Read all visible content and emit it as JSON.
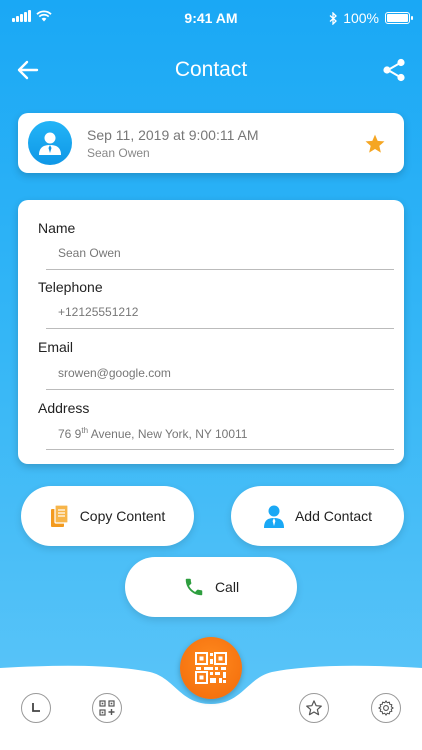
{
  "status_bar": {
    "time": "9:41 AM",
    "battery_text": "100%",
    "battery_level": 1.0
  },
  "header": {
    "title": "Contact"
  },
  "history_item": {
    "timestamp": "Sep 11, 2019 at 9:00:11 AM",
    "name": "Sean Owen",
    "favorited": true
  },
  "contact": {
    "fields": [
      {
        "label": "Name",
        "value": "Sean Owen"
      },
      {
        "label": "Telephone",
        "value": "+12125551212"
      },
      {
        "label": "Email",
        "value": "srowen@google.com"
      },
      {
        "label": "Address",
        "value_prefix": "76 9",
        "value_sup": "th",
        "value_suffix": " Avenue, New York, NY 10011"
      }
    ]
  },
  "actions": {
    "copy_label": "Copy Content",
    "add_contact_label": "Add Contact",
    "call_label": "Call"
  },
  "colors": {
    "accent_blue": "#1aa8f5",
    "scan_orange": "#f26a0a",
    "star_orange": "#f5a623",
    "call_green": "#2e9e3f"
  },
  "icons": {
    "back": "arrow-left-icon",
    "share": "share-icon",
    "avatar": "person-icon",
    "star": "star-icon",
    "copy": "copy-icon",
    "add_contact": "add-contact-icon",
    "call": "phone-icon",
    "history": "clock-icon",
    "create": "qr-add-icon",
    "scan": "qr-scan-icon",
    "favorites": "star-outline-icon",
    "settings": "gear-icon"
  }
}
